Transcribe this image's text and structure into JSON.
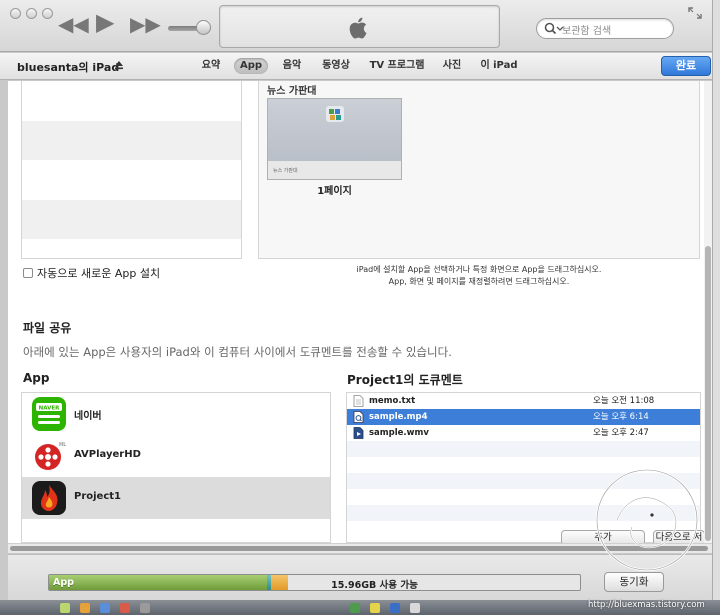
{
  "toolbar": {
    "search_placeholder": "보관함 검색"
  },
  "device": {
    "name": "bluesanta의 iPad",
    "tabs": [
      {
        "label": "요약"
      },
      {
        "label": "App",
        "active": true
      },
      {
        "label": "음악"
      },
      {
        "label": "동영상"
      },
      {
        "label": "TV 프로그램"
      },
      {
        "label": "사진"
      },
      {
        "label": "이 iPad"
      }
    ],
    "done_label": "완료"
  },
  "home_screen": {
    "title": "뉴스 가판대",
    "page_thumb_label": "뉴스 가판대",
    "page_label": "1페이지",
    "hint_line1": "iPad에 설치할 App을 선택하거나 특정 화면으로 App을 드래그하십시오.",
    "hint_line2": "App, 화면 및 페이지를 재정렬하려면 드래그하십시오."
  },
  "auto_install_label": "자동으로 새로운 App 설치",
  "file_sharing": {
    "title": "파일 공유",
    "description": "아래에 있는 App은 사용자의 iPad와 이 컴퓨터 사이에서 도큐멘트를 전송할 수 있습니다.",
    "apps_header": "App",
    "docs_header": "Project1의 도큐멘트",
    "apps": [
      {
        "name": "네이버",
        "icon": "naver-app-icon"
      },
      {
        "name": "AVPlayerHD",
        "icon": "avplayerhd-app-icon"
      },
      {
        "name": "Project1",
        "icon": "project1-app-icon",
        "selected": true
      }
    ],
    "documents": [
      {
        "name": "memo.txt",
        "date": "오늘 오전 11:08",
        "icon": "text-file-icon"
      },
      {
        "name": "sample.mp4",
        "date": "오늘 오후 6:14",
        "icon": "video-file-icon",
        "selected": true
      },
      {
        "name": "sample.wmv",
        "date": "오늘 오후 2:47",
        "icon": "video-file-icon"
      }
    ],
    "add_label": "추가",
    "save_label": "다음으로 저장"
  },
  "capacity": {
    "app_label": "App",
    "free_label": "15.96GB 사용 가능",
    "app_fraction": 0.41,
    "other1_fraction": 0.008,
    "other2_fraction": 0.032,
    "colors": {
      "app": "#8bb858",
      "other1": "#3a9a9c",
      "other2": "#eeb04a"
    }
  },
  "sync_label": "동기화",
  "watermark": "http://bluexmas.tistory.com"
}
